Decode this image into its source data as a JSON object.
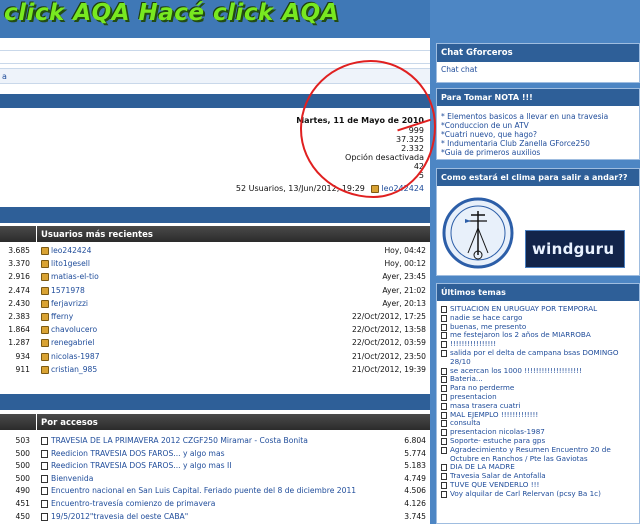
{
  "banner": {
    "text": "click AQA    Hacé click AQA"
  },
  "crumb": {
    "text": "a"
  },
  "stats": {
    "date": "Martes, 11 de Mayo de 2010",
    "l1": "999",
    "l2": "37.325",
    "l3": "2.332",
    "l4": "Opción desactivada",
    "l5": "42",
    "l6": "5",
    "users_line": "52 Usuarios, 13/Jun/2012, 19:29",
    "last_user": "leo242424"
  },
  "recent": {
    "title": "Usuarios más recientes",
    "counts": [
      "3.685",
      "3.370",
      "2.916",
      "2.474",
      "2.430",
      "2.383",
      "1.864",
      "1.287",
      "934",
      "911"
    ],
    "users": [
      {
        "name": "leo242424",
        "when": "Hoy, 04:42"
      },
      {
        "name": "lito1gesell",
        "when": "Hoy, 00:12"
      },
      {
        "name": "matias-el-tio",
        "when": "Ayer, 23:45"
      },
      {
        "name": "1571978",
        "when": "Ayer, 21:02"
      },
      {
        "name": "ferjavrizzi",
        "when": "Ayer, 20:13"
      },
      {
        "name": "fferny",
        "when": "22/Oct/2012, 17:25"
      },
      {
        "name": "chavolucero",
        "when": "22/Oct/2012, 13:58"
      },
      {
        "name": "renegabriel",
        "when": "22/Oct/2012, 03:59"
      },
      {
        "name": "nicolas-1987",
        "when": "21/Oct/2012, 23:50"
      },
      {
        "name": "cristian_985",
        "when": "21/Oct/2012, 19:39"
      }
    ]
  },
  "accesos": {
    "title": "Por accesos",
    "counts": [
      "503",
      "500",
      "500",
      "500",
      "490",
      "451",
      "450"
    ],
    "topics": [
      {
        "name": "TRAVESIA DE LA PRIMAVERA 2012 CZGF250 Miramar - Costa Bonita",
        "views": "6.804"
      },
      {
        "name": "Reedicion TRAVESIA DOS FAROS... y algo mas",
        "views": "5.774"
      },
      {
        "name": "Reedicion TRAVESIA DOS FAROS... y algo mas II",
        "views": "5.183"
      },
      {
        "name": "Bienvenida",
        "views": "4.749"
      },
      {
        "name": "Encuentro nacional en San Luis Capital. Feriado puente del 8 de diciembre 2011",
        "views": "4.506"
      },
      {
        "name": "Encuentro-travesía comienzo de primavera",
        "views": "4.126"
      },
      {
        "name": "19/5/2012\"travesia del oeste CABA\"",
        "views": "3.745"
      }
    ]
  },
  "sidebar": {
    "chat_title": "Chat Gforceros",
    "chat_link": "Chat chat",
    "nota_title": "Para Tomar NOTA !!!",
    "nota_items": [
      "* Elementos basicos a llevar en una travesia",
      "*Conduccion de un ATV",
      "*Cuatri nuevo, que hago?",
      "* Indumentaria Club Zanella GForce250",
      "*Guia de primeros auxilios"
    ],
    "clima_title": "Como estará el clima para salir a andar??",
    "windguru": "windguru",
    "temas_title": "Últimos temas",
    "temas": [
      "SITUACION EN URUGUAY POR TEMPORAL",
      "nadie se hace cargo",
      "buenas, me presento",
      "me festejaron los 2 años de MIARROBA",
      "!!!!!!!!!!!!!!!!",
      "salida por el delta de campana bsas DOMINGO 28/10",
      "se acercan los 1000 !!!!!!!!!!!!!!!!!!!!",
      "Bateria...",
      "Para no perderme",
      "presentacion",
      "masa trasera cuatri",
      "MAL EJEMPLO !!!!!!!!!!!!!",
      "consulta",
      "presentacion nicolas-1987",
      "Soporte- estuche para gps",
      "Agradecimiento y Resumen Encuentro 20 de Octubre en Ranchos / Pte las Gaviotas",
      "DIA DE LA MADRE",
      "Travesia Salar de Antofalla",
      "TUVE QUE VENDERLO !!!",
      "Voy alquilar de Carl Relervan (pcsy Ba 1c)"
    ]
  }
}
